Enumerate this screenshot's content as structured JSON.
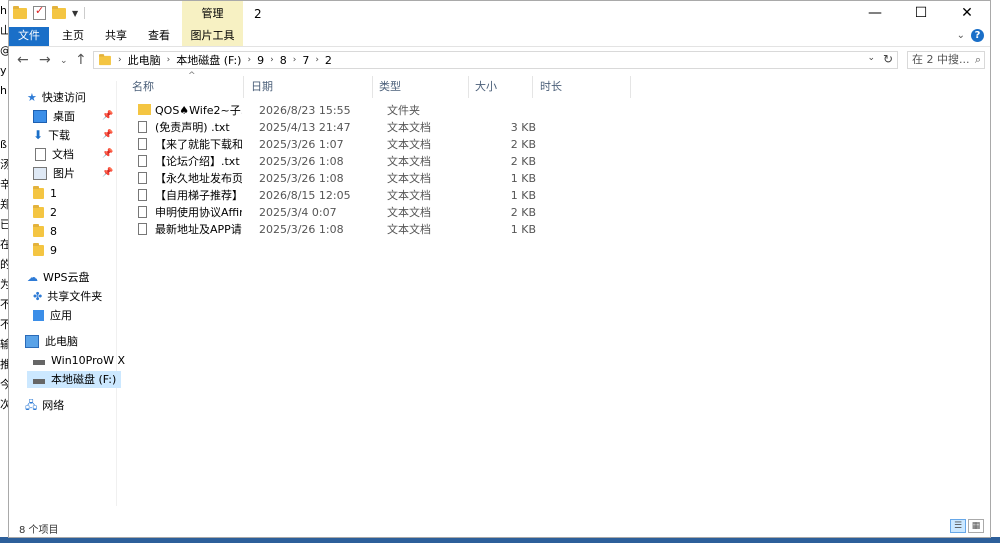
{
  "window": {
    "title": "2",
    "manage_tab": "管理",
    "controls": [
      "—",
      "☐",
      "✕"
    ]
  },
  "ribbon": {
    "tabs": [
      "文件",
      "主页",
      "共享",
      "查看",
      "图片工具"
    ]
  },
  "address": {
    "crumbs": [
      "此电脑",
      "本地磁盘 (F:)",
      "9",
      "8",
      "7",
      "2"
    ],
    "search_placeholder": "在 2 中搜..."
  },
  "sidebar": {
    "quick_access": "快速访问",
    "items": [
      {
        "label": "桌面",
        "icon": "desktop-icon",
        "pinned": true
      },
      {
        "label": "下载",
        "icon": "download-icon",
        "pinned": true
      },
      {
        "label": "文档",
        "icon": "document-icon",
        "pinned": true
      },
      {
        "label": "图片",
        "icon": "picture-icon",
        "pinned": true
      },
      {
        "label": "1",
        "icon": "folder-icon",
        "pinned": false
      },
      {
        "label": "2",
        "icon": "folder-icon",
        "pinned": false
      },
      {
        "label": "8",
        "icon": "folder-icon",
        "pinned": false
      },
      {
        "label": "9",
        "icon": "folder-icon",
        "pinned": false
      }
    ],
    "wps": "WPS云盘",
    "shared": "共享文件夹",
    "apps": "应用",
    "this_pc": "此电脑",
    "drive_c": "Win10ProW X",
    "drive_f": "本地磁盘 (F:)",
    "network": "网络"
  },
  "columns": {
    "name": "名称",
    "date": "日期",
    "type": "类型",
    "size": "大小",
    "duration": "时长"
  },
  "files": [
    {
      "name": "QOS♠Wife2~子...",
      "date": "2026/8/23 15:55",
      "type": "文件夹",
      "size": "",
      "kind": "folder"
    },
    {
      "name": "(免责声明) .txt",
      "date": "2025/4/13 21:47",
      "type": "文本文档",
      "size": "3 KB",
      "kind": "doc"
    },
    {
      "name": "【来了就能下载和...",
      "date": "2025/3/26 1:07",
      "type": "文本文档",
      "size": "2 KB",
      "kind": "doc"
    },
    {
      "name": "【论坛介绍】.txt",
      "date": "2025/3/26 1:08",
      "type": "文本文档",
      "size": "2 KB",
      "kind": "doc"
    },
    {
      "name": "【永久地址发布页...",
      "date": "2025/3/26 1:08",
      "type": "文本文档",
      "size": "1 KB",
      "kind": "doc"
    },
    {
      "name": "【自用梯子推荐】.txt",
      "date": "2026/8/15 12:05",
      "type": "文本文档",
      "size": "1 KB",
      "kind": "doc"
    },
    {
      "name": "申明使用协议Affir...",
      "date": "2025/3/4 0:07",
      "type": "文本文档",
      "size": "2 KB",
      "kind": "doc"
    },
    {
      "name": "最新地址及APP请...",
      "date": "2025/3/26 1:08",
      "type": "文本文档",
      "size": "1 KB",
      "kind": "doc"
    }
  ],
  "status": {
    "count": "8 个项目"
  },
  "background_text": [
    "h",
    "山",
    "@",
    "y",
    "h",
    "ß",
    "汤",
    "辛",
    "郑",
    "已",
    "在",
    "的",
    "为",
    "不",
    "不",
    "输",
    "推",
    "今",
    "次"
  ]
}
